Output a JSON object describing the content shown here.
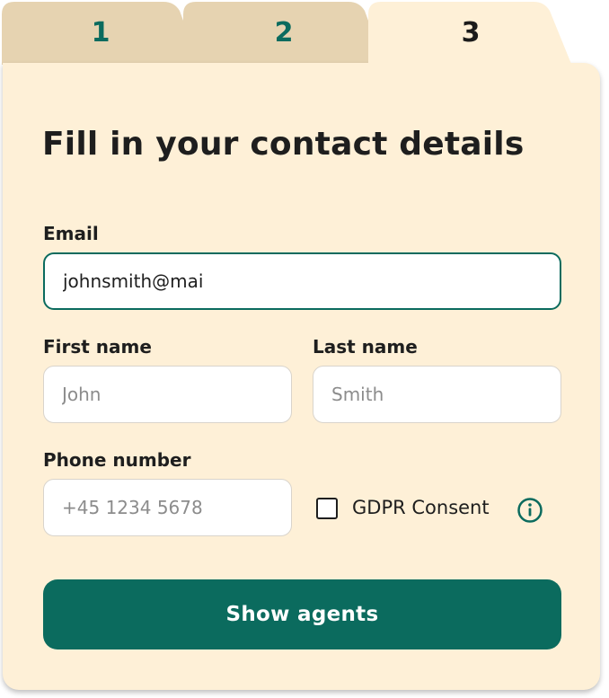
{
  "tabs": [
    {
      "label": "1",
      "active": false
    },
    {
      "label": "2",
      "active": false
    },
    {
      "label": "3",
      "active": true
    }
  ],
  "form": {
    "title": "Fill in your contact details",
    "email": {
      "label": "Email",
      "value": "johnsmith@mai"
    },
    "first_name": {
      "label": "First name",
      "placeholder": "John"
    },
    "last_name": {
      "label": "Last name",
      "placeholder": "Smith"
    },
    "phone": {
      "label": "Phone number",
      "placeholder": "+45 1234 5678"
    },
    "gdpr": {
      "label": "GDPR Consent",
      "checked": false,
      "icon": "info-icon"
    },
    "submit_label": "Show agents"
  },
  "colors": {
    "accent": "#0b6b5e",
    "panel_bg": "#fef0d7",
    "inactive_tab_bg": "#e6d3b1",
    "text": "#1e1e1e"
  }
}
